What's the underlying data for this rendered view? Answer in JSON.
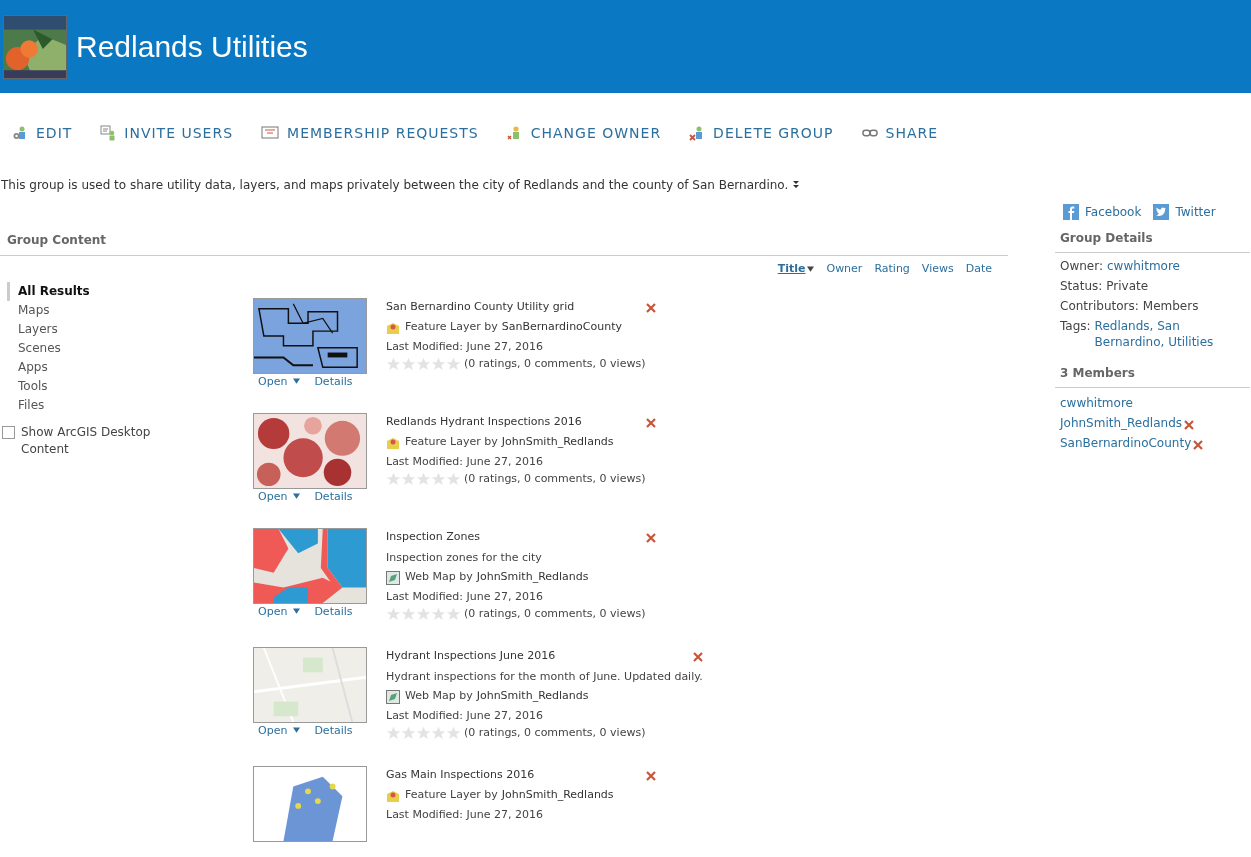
{
  "header": {
    "title": "Redlands Utilities"
  },
  "toolbar": [
    {
      "kind": "edit",
      "label": "EDIT"
    },
    {
      "kind": "invite",
      "label": "INVITE USERS"
    },
    {
      "kind": "requests",
      "label": "MEMBERSHIP REQUESTS"
    },
    {
      "kind": "owner",
      "label": "CHANGE OWNER"
    },
    {
      "kind": "delete",
      "label": "DELETE GROUP"
    },
    {
      "kind": "share",
      "label": "SHARE"
    }
  ],
  "description": "This group is used to share utility data, layers, and maps privately between the city of Redlands and the county of San Bernardino.",
  "group_content": {
    "title": "Group Content",
    "filters": [
      {
        "label": "All Results",
        "selected": true
      },
      {
        "label": "Maps",
        "selected": false
      },
      {
        "label": "Layers",
        "selected": false
      },
      {
        "label": "Scenes",
        "selected": false
      },
      {
        "label": "Apps",
        "selected": false
      },
      {
        "label": "Tools",
        "selected": false
      },
      {
        "label": "Files",
        "selected": false
      }
    ],
    "desktop_checkbox": {
      "label": "Show ArcGIS Desktop Content",
      "checked": false
    },
    "sort": [
      {
        "label": "Title",
        "selected": true
      },
      {
        "label": "Owner",
        "selected": false
      },
      {
        "label": "Rating",
        "selected": false
      },
      {
        "label": "Views",
        "selected": false
      },
      {
        "label": "Date",
        "selected": false
      }
    ],
    "items": [
      {
        "title": "San Bernardino County Utility grid",
        "kind": "feature_layer",
        "type": "Feature Layer by",
        "owner": "SanBernardinoCounty",
        "modified": "Last Modified: June 27, 2016",
        "stars": 0,
        "stats": "(0 ratings, 0 comments, 0 views)",
        "open": "Open",
        "details": "Details"
      },
      {
        "title": "Redlands Hydrant Inspections 2016",
        "kind": "feature_layer",
        "type": "Feature Layer by",
        "owner": "JohnSmith_Redlands",
        "modified": "Last Modified: June 27, 2016",
        "stars": 0,
        "stats": "(0 ratings, 0 comments, 0 views)",
        "open": "Open",
        "details": "Details"
      },
      {
        "title": "Inspection Zones",
        "description": "Inspection zones for the city",
        "kind": "web_map",
        "type": "Web Map by",
        "owner": "JohnSmith_Redlands",
        "modified": "Last Modified: June 27, 2016",
        "stars": 0,
        "stats": "(0 ratings, 0 comments, 0 views)",
        "open": "Open",
        "details": "Details"
      },
      {
        "title": "Hydrant Inspections June 2016",
        "description": "Hydrant inspections for the month of June. Updated daily.",
        "kind": "web_map",
        "type": "Web Map by",
        "owner": "JohnSmith_Redlands",
        "modified": "Last Modified: June 27, 2016",
        "stars": 0,
        "stats": "(0 ratings, 0 comments, 0 views)",
        "open": "Open",
        "details": "Details"
      },
      {
        "title": "Gas Main Inspections 2016",
        "kind": "feature_layer",
        "type": "Feature Layer by",
        "owner": "JohnSmith_Redlands",
        "modified": "Last Modified: June 27, 2016"
      }
    ]
  },
  "social": [
    {
      "kind": "facebook",
      "label": "Facebook"
    },
    {
      "kind": "twitter",
      "label": "Twitter"
    }
  ],
  "group_details": {
    "title": "Group Details",
    "rows": [
      {
        "label": "Owner:",
        "value": "cwwhitmore",
        "link": true
      },
      {
        "label": "Status:",
        "value": "Private",
        "link": false
      },
      {
        "label": "Contributors:",
        "value": "Members",
        "link": false
      },
      {
        "label": "Tags:",
        "value": "Redlands, San Bernardino, Utilities",
        "link": true
      }
    ]
  },
  "members": {
    "title": "3 Members",
    "list": [
      {
        "name": "cwwhitmore",
        "removable": false
      },
      {
        "name": "JohnSmith_Redlands",
        "removable": true
      },
      {
        "name": "SanBernardinoCounty",
        "removable": true
      }
    ]
  }
}
